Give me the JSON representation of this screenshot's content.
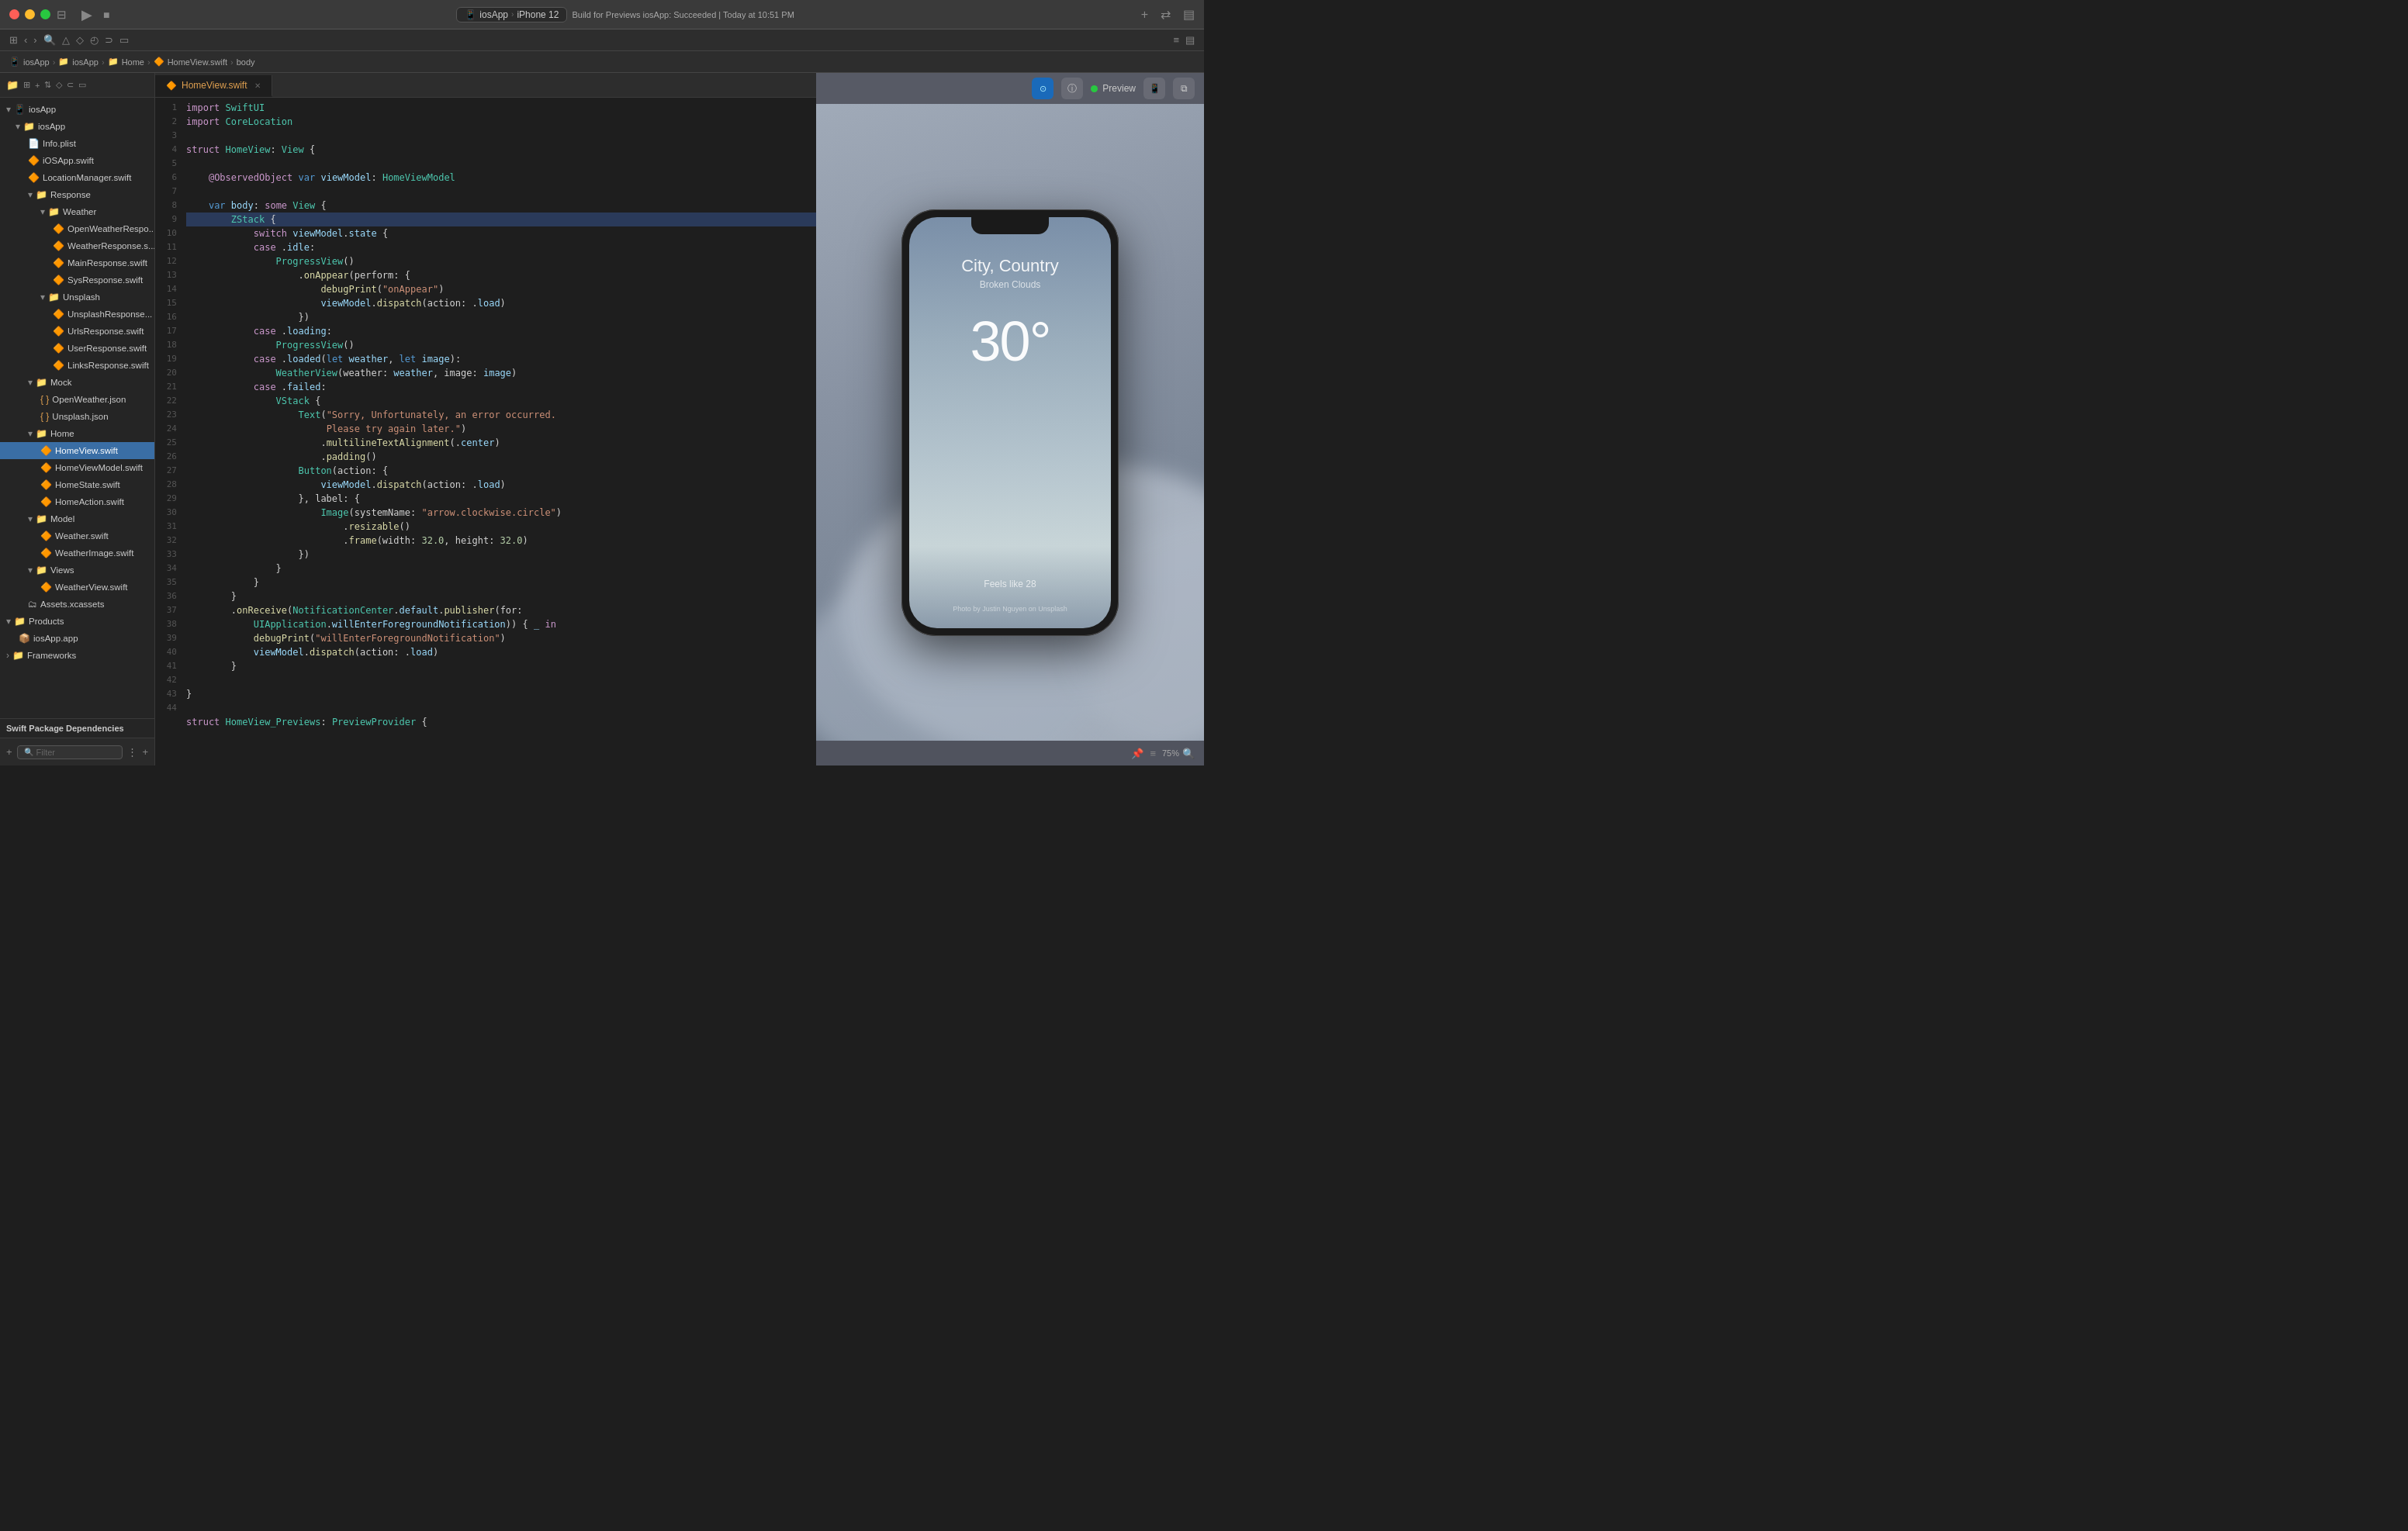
{
  "titlebar": {
    "scheme": "iosApp",
    "device": "iPhone 12",
    "status": "Build for Previews iosApp: Succeeded | Today at 10:51 PM"
  },
  "breadcrumb": {
    "items": [
      "iosApp",
      "iosApp",
      "Home",
      "HomeView.swift",
      "body"
    ]
  },
  "sidebar": {
    "root_label": "iosApp",
    "items": [
      {
        "id": "iosApp",
        "label": "iosApp",
        "level": 1,
        "type": "folder",
        "expanded": true
      },
      {
        "id": "Info.plist",
        "label": "Info.plist",
        "level": 2,
        "type": "plist"
      },
      {
        "id": "iOSApp.swift",
        "label": "iOSApp.swift",
        "level": 2,
        "type": "swift"
      },
      {
        "id": "LocationManager.swift",
        "label": "LocationManager.swift",
        "level": 2,
        "type": "swift"
      },
      {
        "id": "Response",
        "label": "Response",
        "level": 2,
        "type": "folder",
        "expanded": true
      },
      {
        "id": "Weather",
        "label": "Weather",
        "level": 3,
        "type": "folder",
        "expanded": true
      },
      {
        "id": "OpenWeatherRespo",
        "label": "OpenWeatherRespo...",
        "level": 4,
        "type": "swift"
      },
      {
        "id": "WeatherResponse.s",
        "label": "WeatherResponse.s...",
        "level": 4,
        "type": "swift"
      },
      {
        "id": "MainResponse.swift",
        "label": "MainResponse.swift",
        "level": 4,
        "type": "swift"
      },
      {
        "id": "SysResponse.swift",
        "label": "SysResponse.swift",
        "level": 4,
        "type": "swift"
      },
      {
        "id": "Unsplash",
        "label": "Unsplash",
        "level": 3,
        "type": "folder",
        "expanded": true
      },
      {
        "id": "UnsplashResponse",
        "label": "UnsplashResponse...",
        "level": 4,
        "type": "swift"
      },
      {
        "id": "UrlsResponse.swift",
        "label": "UrlsResponse.swift",
        "level": 4,
        "type": "swift"
      },
      {
        "id": "UserResponse.swift",
        "label": "UserResponse.swift",
        "level": 4,
        "type": "swift"
      },
      {
        "id": "LinksResponse.swift",
        "label": "LinksResponse.swift",
        "level": 4,
        "type": "swift"
      },
      {
        "id": "Mock",
        "label": "Mock",
        "level": 2,
        "type": "folder",
        "expanded": true
      },
      {
        "id": "OpenWeather.json",
        "label": "OpenWeather.json",
        "level": 3,
        "type": "json"
      },
      {
        "id": "Unsplash.json",
        "label": "Unsplash.json",
        "level": 3,
        "type": "json"
      },
      {
        "id": "Home",
        "label": "Home",
        "level": 2,
        "type": "folder",
        "expanded": true
      },
      {
        "id": "HomeView.swift",
        "label": "HomeView.swift",
        "level": 3,
        "type": "swift",
        "selected": true
      },
      {
        "id": "HomeViewModel.swift",
        "label": "HomeViewModel.swift",
        "level": 3,
        "type": "swift"
      },
      {
        "id": "HomeState.swift",
        "label": "HomeState.swift",
        "level": 3,
        "type": "swift"
      },
      {
        "id": "HomeAction.swift",
        "label": "HomeAction.swift",
        "level": 3,
        "type": "swift"
      },
      {
        "id": "Model",
        "label": "Model",
        "level": 2,
        "type": "folder",
        "expanded": true
      },
      {
        "id": "Weather.swift",
        "label": "Weather.swift",
        "level": 3,
        "type": "swift"
      },
      {
        "id": "WeatherImage.swift",
        "label": "WeatherImage.swift",
        "level": 3,
        "type": "swift"
      },
      {
        "id": "Views",
        "label": "Views",
        "level": 2,
        "type": "folder",
        "expanded": true
      },
      {
        "id": "WeatherView.swift",
        "label": "WeatherView.swift",
        "level": 3,
        "type": "swift"
      },
      {
        "id": "Assets.xcassets",
        "label": "Assets.xcassets",
        "level": 2,
        "type": "xcassets"
      },
      {
        "id": "Products",
        "label": "Products",
        "level": 1,
        "type": "folder",
        "expanded": true
      },
      {
        "id": "iosApp.app",
        "label": "iosApp.app",
        "level": 2,
        "type": "app"
      },
      {
        "id": "Frameworks",
        "label": "Frameworks",
        "level": 1,
        "type": "folder"
      }
    ],
    "swift_deps_label": "Swift Package Dependencies",
    "filter_placeholder": "Filter"
  },
  "tab": {
    "filename": "HomeView.swift",
    "icon": "🔶"
  },
  "code": {
    "lines": [
      {
        "n": 1,
        "text": "import SwiftUI"
      },
      {
        "n": 2,
        "text": "import CoreLocation"
      },
      {
        "n": 3,
        "text": ""
      },
      {
        "n": 4,
        "text": "struct HomeView: View {"
      },
      {
        "n": 5,
        "text": ""
      },
      {
        "n": 6,
        "text": "    @ObservedObject var viewModel: HomeViewModel"
      },
      {
        "n": 7,
        "text": ""
      },
      {
        "n": 8,
        "text": "    var body: some View {"
      },
      {
        "n": 9,
        "text": "        ZStack {",
        "highlight": true
      },
      {
        "n": 10,
        "text": "            switch viewModel.state {"
      },
      {
        "n": 11,
        "text": "            case .idle:"
      },
      {
        "n": 12,
        "text": "                ProgressView()"
      },
      {
        "n": 13,
        "text": "                    .onAppear(perform: {"
      },
      {
        "n": 14,
        "text": "                        debugPrint(\"onAppear\")"
      },
      {
        "n": 15,
        "text": "                        viewModel.dispatch(action: .load)"
      },
      {
        "n": 16,
        "text": "                    })"
      },
      {
        "n": 17,
        "text": "            case .loading:"
      },
      {
        "n": 18,
        "text": "                ProgressView()"
      },
      {
        "n": 19,
        "text": "            case .loaded(let weather, let image):"
      },
      {
        "n": 20,
        "text": "                WeatherView(weather: weather, image: image)"
      },
      {
        "n": 21,
        "text": "            case .failed:"
      },
      {
        "n": 22,
        "text": "                VStack {"
      },
      {
        "n": 23,
        "text": "                    Text(\"Sorry, Unfortunately, an error occurred."
      },
      {
        "n": 24,
        "text": "                         Please try again later.\")"
      },
      {
        "n": 25,
        "text": "                        .multilineTextAlignment(.center)"
      },
      {
        "n": 26,
        "text": "                        .padding()"
      },
      {
        "n": 27,
        "text": "                    Button(action: {"
      },
      {
        "n": 28,
        "text": "                        viewModel.dispatch(action: .load)"
      },
      {
        "n": 29,
        "text": "                    }, label: {"
      },
      {
        "n": 30,
        "text": "                        Image(systemName: \"arrow.clockwise.circle\")"
      },
      {
        "n": 31,
        "text": "                            .resizable()"
      },
      {
        "n": 32,
        "text": "                            .frame(width: 32.0, height: 32.0)"
      },
      {
        "n": 33,
        "text": "                    })"
      },
      {
        "n": 34,
        "text": "                }"
      },
      {
        "n": 35,
        "text": "            }"
      },
      {
        "n": 36,
        "text": "        }"
      },
      {
        "n": 37,
        "text": "        .onReceive(NotificationCenter.default.publisher(for:"
      },
      {
        "n": 38,
        "text": "            UIApplication.willEnterForegroundNotification)) { _ in"
      },
      {
        "n": 39,
        "text": "            debugPrint(\"willEnterForegroundNotification\")"
      },
      {
        "n": 40,
        "text": "            viewModel.dispatch(action: .load)"
      },
      {
        "n": 41,
        "text": "        }"
      },
      {
        "n": 42,
        "text": ""
      },
      {
        "n": 43,
        "text": "}"
      },
      {
        "n": 44,
        "text": ""
      }
    ]
  },
  "preview": {
    "label": "Preview",
    "device": "iPhone 12",
    "weather": {
      "city": "City, Country",
      "description": "Broken Clouds",
      "temperature": "30°",
      "feels_like": "Feels like 28",
      "photo_credit": "Photo by Justin Nguyen on Unsplash"
    },
    "zoom": "75%"
  }
}
